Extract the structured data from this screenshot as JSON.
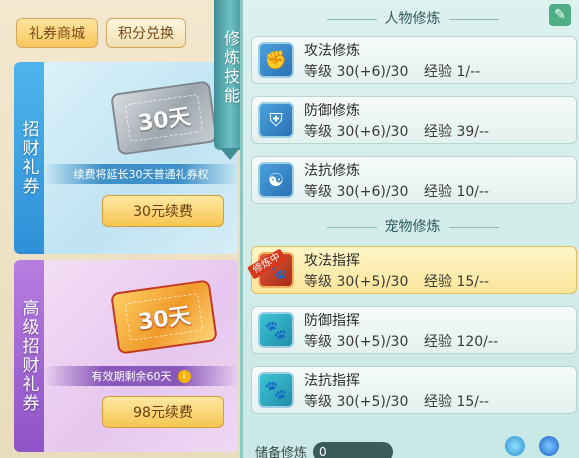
{
  "shop": {
    "tabs": [
      {
        "label": "礼券商城",
        "active": true
      },
      {
        "label": "积分兑换",
        "active": false
      }
    ],
    "cards": [
      {
        "ribbon": "招财礼券",
        "ticket_text": "30天",
        "note": "续费将延长30天普通礼券权",
        "button": "30元续费"
      },
      {
        "ribbon": "高级招财礼券",
        "ticket_text": "30天",
        "note": "有效期剩余60天",
        "button": "98元续费"
      }
    ]
  },
  "scroll_label": "修炼技能",
  "training": {
    "character_title": "人物修炼",
    "pet_title": "宠物修炼",
    "level_label": "等级",
    "exp_label": "经验",
    "training_badge": "修炼中",
    "character_rows": [
      {
        "name": "攻法修炼",
        "level": "30(+6)/30",
        "exp": "1/--",
        "icon": "fist-icon",
        "color": "blue"
      },
      {
        "name": "防御修炼",
        "level": "30(+6)/30",
        "exp": "39/--",
        "icon": "shield-icon",
        "color": "blue"
      },
      {
        "name": "法抗修炼",
        "level": "30(+6)/30",
        "exp": "10/--",
        "icon": "yin-yang-icon",
        "color": "blue"
      }
    ],
    "pet_rows": [
      {
        "name": "攻法指挥",
        "level": "30(+5)/30",
        "exp": "15/--",
        "icon": "paw-attack-icon",
        "color": "red",
        "active": true
      },
      {
        "name": "防御指挥",
        "level": "30(+5)/30",
        "exp": "120/--",
        "icon": "paw-defense-icon",
        "color": "teal"
      },
      {
        "name": "法抗指挥",
        "level": "30(+5)/30",
        "exp": "15/--",
        "icon": "paw-resist-icon",
        "color": "teal"
      }
    ],
    "storage_label": "储备修炼",
    "storage_value": "0"
  }
}
